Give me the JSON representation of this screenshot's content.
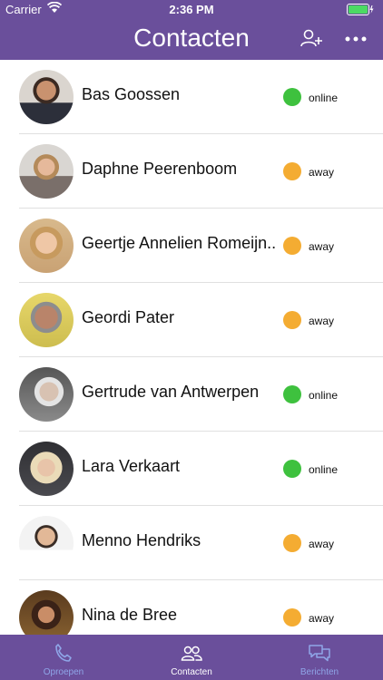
{
  "statusbar": {
    "carrier": "Carrier",
    "time": "2:36 PM"
  },
  "header": {
    "title": "Contacten"
  },
  "colors": {
    "brand": "#6a4f9b",
    "online": "#3ec13e",
    "away": "#f4ac32",
    "tab_active": "#ffffff",
    "tab_inactive": "#8fa6e8"
  },
  "contacts": [
    {
      "name": "Bas Goossen",
      "status": "online"
    },
    {
      "name": "Daphne Peerenboom",
      "status": "away"
    },
    {
      "name": "Geertje Annelien Romeijn...",
      "status": "away"
    },
    {
      "name": "Geordi Pater",
      "status": "away"
    },
    {
      "name": "Gertrude van Antwerpen",
      "status": "online"
    },
    {
      "name": "Lara Verkaart",
      "status": "online"
    },
    {
      "name": "Menno Hendriks",
      "status": "away"
    },
    {
      "name": "Nina de Bree",
      "status": "away"
    }
  ],
  "tabs": [
    {
      "label": "Oproepen",
      "icon": "phone-icon",
      "active": false
    },
    {
      "label": "Contacten",
      "icon": "contacts-icon",
      "active": true
    },
    {
      "label": "Berichten",
      "icon": "messages-icon",
      "active": false
    }
  ]
}
